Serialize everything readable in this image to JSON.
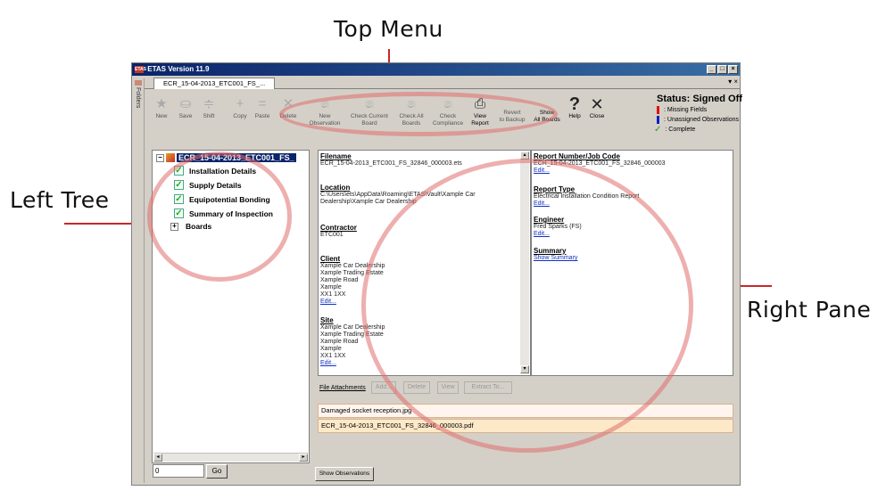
{
  "annotations": {
    "top_menu": "Top Menu",
    "left_tree": "Left Tree",
    "right_pane": "Right Pane"
  },
  "window": {
    "title": "ETAS Version 11.9",
    "icon_text": "ETAS",
    "minimize": "_",
    "maximize": "□",
    "close": "×"
  },
  "doc_tab": {
    "label": "ECR_15-04-2013_ETC001_FS_...",
    "tab_controls": "▾ ×"
  },
  "sidebar": {
    "folders_label": "Folders"
  },
  "toolbar": {
    "new": "New",
    "save": "Save",
    "shift": "Shift",
    "copy": "Copy",
    "paste": "Paste",
    "delete": "Delete",
    "new_observation_1": "New",
    "new_observation_2": "Observation",
    "check_current_1": "Check Current",
    "check_current_2": "Board",
    "check_all_1": "Check All",
    "check_all_2": "Boards",
    "check_compliance_1": "Check",
    "check_compliance_2": "Compliance",
    "view_report_1": "View",
    "view_report_2": "Report",
    "revert_1": "Revert",
    "revert_2": "to Backup",
    "show_all_1": "Show",
    "show_all_2": "All Boards",
    "help": "Help",
    "close": "Close"
  },
  "status": {
    "title": "Status: Signed Off",
    "missing": ": Missing Fields",
    "unassigned": ": Unassigned Observations",
    "complete": ": Complete",
    "colors": {
      "missing": "#e01010",
      "unassigned": "#1020c0",
      "complete": "#2a9a2a"
    }
  },
  "tree": {
    "root": "ECR_15-04-2013_ETC001_FS_",
    "items": [
      "Installation Details",
      "Supply Details",
      "Equipotential Bonding",
      "Summary of Inspection",
      "Boards"
    ]
  },
  "goto": {
    "value": "0",
    "button": "Go"
  },
  "details": {
    "filename_h": "Filename",
    "filename": "ECR_15-04-2013_ETC001_FS_32846_000003.ets",
    "location_h": "Location",
    "location_1": "C:\\Users\\ets\\AppData\\Roaming\\ETAS\\Vault\\Xample Car",
    "location_2": "Dealership\\Xample Car Dealership",
    "contractor_h": "Contractor",
    "contractor": "ETC001",
    "client_h": "Client",
    "client_lines": [
      "Xample Car Dealership",
      "Xample Trading Estate",
      "Xample Road",
      "Xample",
      "XX1 1XX"
    ],
    "site_h": "Site",
    "site_lines": [
      "Xample Car Dealership",
      "Xample Trading Estate",
      "Xample Road",
      "Xample",
      "XX1 1XX"
    ],
    "edit": "Edit..."
  },
  "right": {
    "report_no_h": "Report Number/Job Code",
    "report_no": "ECR_15-04-2013_ETC001_FS_32846_000003",
    "report_type_h": "Report Type",
    "report_type": "Electrical Installation Condition Report",
    "engineer_h": "Engineer",
    "engineer": "Fred Sparks (FS)",
    "summary_h": "Summary",
    "show_summary": "Show Summary",
    "edit": "Edit..."
  },
  "attachments": {
    "label": "File Attachments",
    "add": "Add...",
    "delete": "Delete",
    "view": "View",
    "extract": "Extract To...",
    "files": [
      "Damaged socket reception.jpg",
      "ECR_15-04-2013_ETC001_FS_32846_000003.pdf"
    ]
  },
  "show_observations": "Show Observations"
}
